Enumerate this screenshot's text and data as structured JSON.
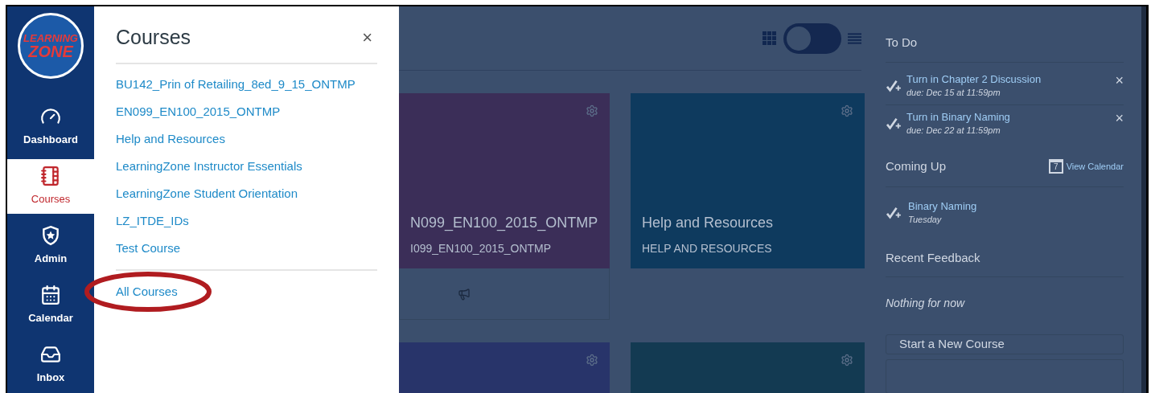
{
  "logo": {
    "line1": "LEARNING",
    "line2": "ZONE"
  },
  "nav": [
    {
      "kind": "dashboard",
      "label": "Dashboard",
      "selected": false
    },
    {
      "kind": "courses",
      "label": "Courses",
      "selected": true
    },
    {
      "kind": "admin",
      "label": "Admin",
      "selected": false
    },
    {
      "kind": "calendar",
      "label": "Calendar",
      "selected": false
    },
    {
      "kind": "inbox",
      "label": "Inbox",
      "selected": false
    }
  ],
  "flyout": {
    "title": "Courses",
    "close": "×",
    "courses": [
      "BU142_Prin of Retailing_8ed_9_15_ONTMP",
      "EN099_EN100_2015_ONTMP",
      "Help and Resources",
      "LearningZone Instructor Essentials",
      "LearningZone Student Orientation",
      "LZ_ITDE_IDs",
      "Test Course"
    ],
    "all_courses": {
      "label": "All Courses",
      "highlighted": true
    }
  },
  "view_toggle": {
    "on": false
  },
  "cards": [
    {
      "title": "N099_EN100_2015_ONTMP",
      "subtitle": "I099_EN100_2015_ONTMP",
      "color": "#3b2e58",
      "footer": true
    },
    {
      "title": "Help and Resources",
      "subtitle": "HELP AND RESOURCES",
      "color": "#0e3a5e"
    },
    {
      "color": "#28346a"
    },
    {
      "color": "#133a52"
    }
  ],
  "todo": {
    "title": "To Do",
    "items": [
      {
        "title": "Turn in Chapter 2 Discussion",
        "due": "due: Dec 15 at 11:59pm",
        "close": "×"
      },
      {
        "title": "Turn in Binary Naming",
        "due": "due: Dec 22 at 11:59pm",
        "close": "×"
      }
    ]
  },
  "coming_up": {
    "title": "Coming Up",
    "calendar_day": "7",
    "link": "View Calendar",
    "items": [
      {
        "title": "Binary Naming",
        "when": "Tuesday"
      }
    ]
  },
  "feedback": {
    "title": "Recent Feedback",
    "empty": "Nothing for now"
  },
  "buttons": [
    "Start a New Course"
  ]
}
